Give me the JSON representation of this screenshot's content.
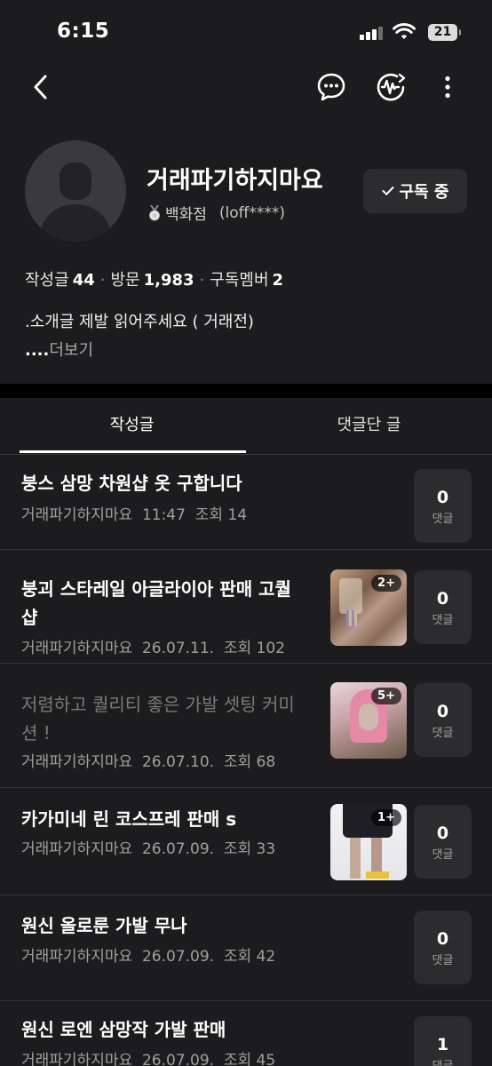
{
  "status_bar": {
    "time": "6:15",
    "battery": "21"
  },
  "profile": {
    "nickname": "거래파기하지마요",
    "grade": "백화점",
    "user_id": "(loff****)",
    "subscribe_label": "구독 중"
  },
  "stats": {
    "posts_label": "작성글",
    "posts_value": "44",
    "visits_label": "방문",
    "visits_value": "1,983",
    "members_label": "구독멤버",
    "members_value": "2"
  },
  "intro": {
    "text": ".소개글 제발 읽어주세요 ( 거래전)",
    "more_dots": "....",
    "more_label": "더보기"
  },
  "tabs": {
    "posts": "작성글",
    "commented": "댓글단 글"
  },
  "comment_label": "댓글",
  "posts": [
    {
      "title": "붕스 삼망 차원샵 옷 구합니다",
      "title2": "",
      "author": "거래파기하지마요",
      "date": "11:47",
      "views_label": "조회",
      "views": "14",
      "comments": "0",
      "thumb_count": "",
      "dim": false
    },
    {
      "title": "붕괴 스타레일 아글라이아 판매 고퀄",
      "title2": "샵",
      "author": "거래파기하지마요",
      "date": "26.07.11.",
      "views_label": "조회",
      "views": "102",
      "comments": "0",
      "thumb_count": "2+",
      "dim": false
    },
    {
      "title": "저렴하고 퀄리티 좋은 가발 셋팅 커미",
      "title2": "션 !",
      "author": "거래파기하지마요",
      "date": "26.07.10.",
      "views_label": "조회",
      "views": "68",
      "comments": "0",
      "thumb_count": "5+",
      "dim": true
    },
    {
      "title": "카가미네 린 코스프레 판매 s",
      "title2": "",
      "author": "거래파기하지마요",
      "date": "26.07.09.",
      "views_label": "조회",
      "views": "33",
      "comments": "0",
      "thumb_count": "1+",
      "dim": false
    },
    {
      "title": "원신 올로룬 가발 무나",
      "title2": "",
      "author": "거래파기하지마요",
      "date": "26.07.09.",
      "views_label": "조회",
      "views": "42",
      "comments": "0",
      "thumb_count": "",
      "dim": false
    },
    {
      "title": "원신 로엔 삼망작 가발 판매",
      "title2": "",
      "author": "거래파기하지마요",
      "date": "26.07.09.",
      "views_label": "조회",
      "views": "45",
      "comments": "1",
      "thumb_count": "",
      "dim": false
    }
  ]
}
